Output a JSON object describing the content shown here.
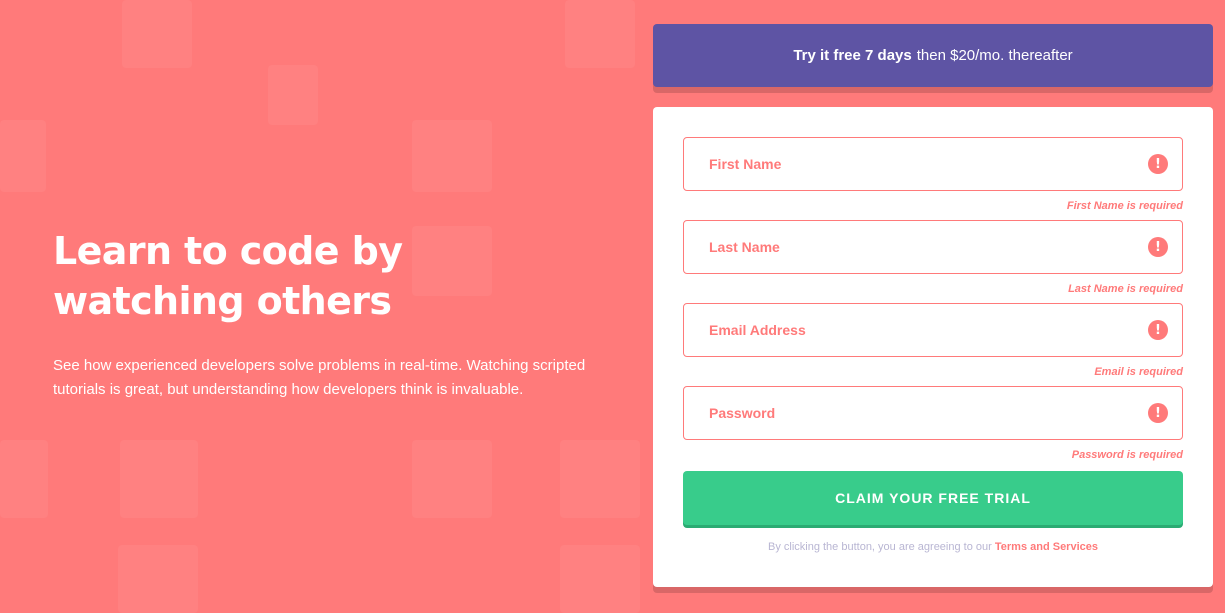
{
  "promo": {
    "bold": "Try it free 7 days",
    "rest": "then $20/mo. thereafter"
  },
  "hero": {
    "title": "Learn to code by watching others",
    "description": "See how experienced developers solve problems in real-time. Watching scripted tutorials is great, but understanding how developers think is invaluable."
  },
  "form": {
    "fields": [
      {
        "placeholder": "First Name",
        "error": "First Name is required"
      },
      {
        "placeholder": "Last Name",
        "error": "Last Name is required"
      },
      {
        "placeholder": "Email Address",
        "error": "Email is required"
      },
      {
        "placeholder": "Password",
        "error": "Password is required"
      }
    ],
    "error_icon": "!",
    "submit_label": "CLAIM YOUR FREE TRIAL",
    "terms_prefix": "By clicking the button, you are agreeing to our",
    "terms_link": "Terms and Services"
  },
  "colors": {
    "background": "#ff7a7a",
    "promo": "#5e54a4",
    "cta": "#38cc8b",
    "error": "#ff7a7a"
  }
}
